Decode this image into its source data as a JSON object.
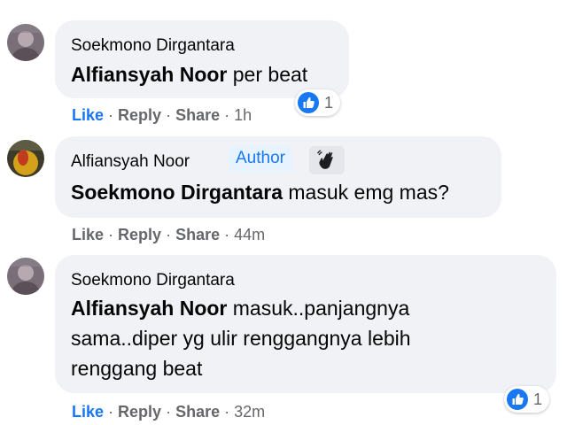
{
  "comments": [
    {
      "author": "Soekmono Dirgantara",
      "mention": "Alfiansyah Noor",
      "text": " per beat",
      "actions": {
        "like": "Like",
        "reply": "Reply",
        "share": "Share",
        "time": "1h"
      },
      "reactions": {
        "count": "1",
        "icon": "like-icon"
      },
      "liked": true
    },
    {
      "author": "Alfiansyah Noor",
      "badge": "Author",
      "badge_icon": "wave-icon",
      "mention": "Soekmono Dirgantara",
      "text": " masuk emg mas?",
      "actions": {
        "like": "Like",
        "reply": "Reply",
        "share": "Share",
        "time": "44m"
      },
      "liked": false
    },
    {
      "author": "Soekmono Dirgantara",
      "mention": "Alfiansyah Noor",
      "text_line1": " masuk..panjangnya",
      "text_line2": "sama..diper yg ulir renggangnya lebih",
      "text_line3": "renggang beat",
      "actions": {
        "like": "Like",
        "reply": "Reply",
        "share": "Share",
        "time": "32m"
      },
      "reactions": {
        "count": "1",
        "icon": "like-icon"
      },
      "liked": true
    }
  ],
  "colors": {
    "bubble": "#f0f2f5",
    "link_blue": "#1877f2",
    "muted": "#65676b",
    "author_badge_bg": "#e7f3ff"
  }
}
